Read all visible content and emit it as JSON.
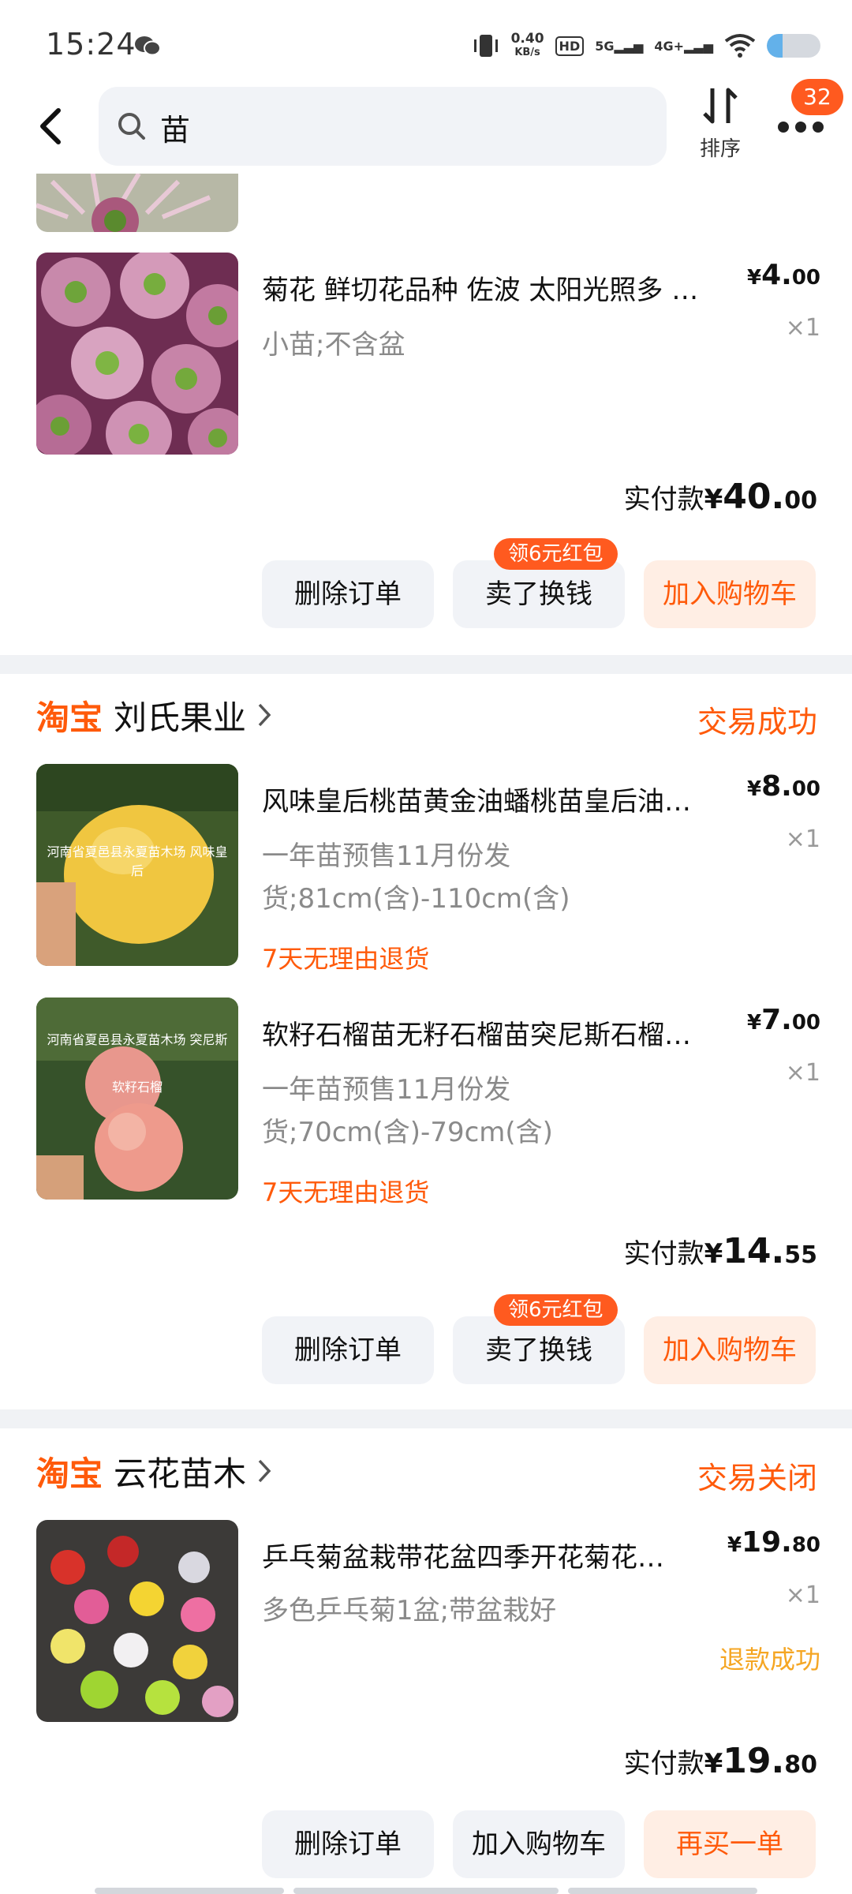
{
  "status_bar": {
    "time": "15:24",
    "net_speed_value": "0.40",
    "net_speed_unit": "KB/s",
    "hd_label": "HD",
    "sim1": "5G",
    "sim2": "4G+",
    "battery_level": 0.3
  },
  "header": {
    "search_query": "苗",
    "sort_label": "排序",
    "notification_count": "32"
  },
  "orders": [
    {
      "items": [
        {
          "title": "菊花 鲜切花品种 佐波 太阳光照多 …",
          "price_symbol": "¥",
          "price_int": "4.",
          "price_dec": "00",
          "qty": "×1",
          "spec": "小苗;不含盆",
          "thumb": "chrysanthemum-purple"
        }
      ],
      "paid_label": "实付款",
      "paid_symbol": "¥",
      "paid_int": "40.",
      "paid_dec": "00",
      "buttons": [
        "删除订单",
        "卖了换钱",
        "加入购物车"
      ],
      "badge": "领6元红包"
    },
    {
      "platform": "淘宝",
      "shop": "刘氏果业",
      "status": "交易成功",
      "items": [
        {
          "title": "风味皇后桃苗黄金油蟠桃苗皇后油…",
          "price_symbol": "¥",
          "price_int": "8.",
          "price_dec": "00",
          "qty": "×1",
          "spec": "一年苗预售11月份发货;81cm(含)-110cm(含)",
          "tag": "7天无理由退货",
          "thumb": "peach",
          "thumb_caption": "河南省夏邑县永夏苗木场 风味皇后"
        },
        {
          "title": "软籽石榴苗无籽石榴苗突尼斯石榴…",
          "price_symbol": "¥",
          "price_int": "7.",
          "price_dec": "00",
          "qty": "×1",
          "spec": "一年苗预售11月份发货;70cm(含)-79cm(含)",
          "tag": "7天无理由退货",
          "thumb": "pomegranate",
          "thumb_caption": "河南省夏邑县永夏苗木场 突尼斯软籽石榴"
        }
      ],
      "paid_label": "实付款",
      "paid_symbol": "¥",
      "paid_int": "14.",
      "paid_dec": "55",
      "buttons": [
        "删除订单",
        "卖了换钱",
        "加入购物车"
      ],
      "badge": "领6元红包"
    },
    {
      "platform": "淘宝",
      "shop": "云花苗木",
      "status": "交易关闭",
      "items": [
        {
          "title": "乒乓菊盆栽带花盆四季开花菊花…",
          "price_symbol": "¥",
          "price_int": "19.",
          "price_dec": "80",
          "qty": "×1",
          "spec": "多色乒乓菊1盆;带盆栽好",
          "refund": "退款成功",
          "thumb": "pompon-mums"
        }
      ],
      "paid_label": "实付款",
      "paid_symbol": "¥",
      "paid_int": "19.",
      "paid_dec": "80",
      "buttons": [
        "删除订单",
        "加入购物车",
        "再买一单"
      ]
    }
  ],
  "colors": {
    "accent": "#ff5a0a",
    "badge_bg": "#ff5a1f",
    "refund": "#f5a623",
    "button_bg": "#f1f3f7",
    "primary_button_bg": "#ffeee4",
    "divider": "#f0f2f5"
  }
}
